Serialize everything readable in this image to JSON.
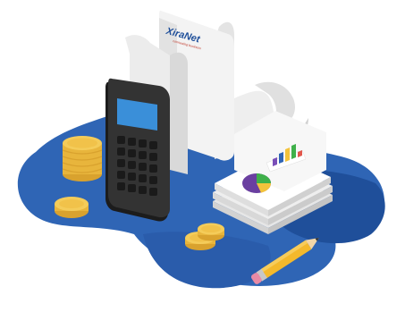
{
  "logo": {
    "brand": "XiraNet",
    "tagline": "connecting business"
  },
  "colors": {
    "background": "#ffffff",
    "blob_dark": "#1f4f9a",
    "blob_mid": "#2f65b5",
    "blob_light": "#4a82cc",
    "paper": "#f2f2f2",
    "paper_shadow": "#d6d6d6",
    "calculator_body": "#2b2b2b",
    "calculator_screen": "#3a8fd9",
    "coin": "#f1c24a",
    "coin_edge": "#d9a22e",
    "pencil": "#f4b92c",
    "pie_purple": "#6a3fa0",
    "pie_green": "#3fb04a",
    "pie_yellow": "#f3c33b",
    "bar_blue": "#2f65b5",
    "bar_purple": "#7a4fb8"
  },
  "icons": [
    "calculator-icon",
    "receipt-icon",
    "coin-stack-icon",
    "pie-chart-icon",
    "bar-chart-icon",
    "pencil-icon"
  ]
}
